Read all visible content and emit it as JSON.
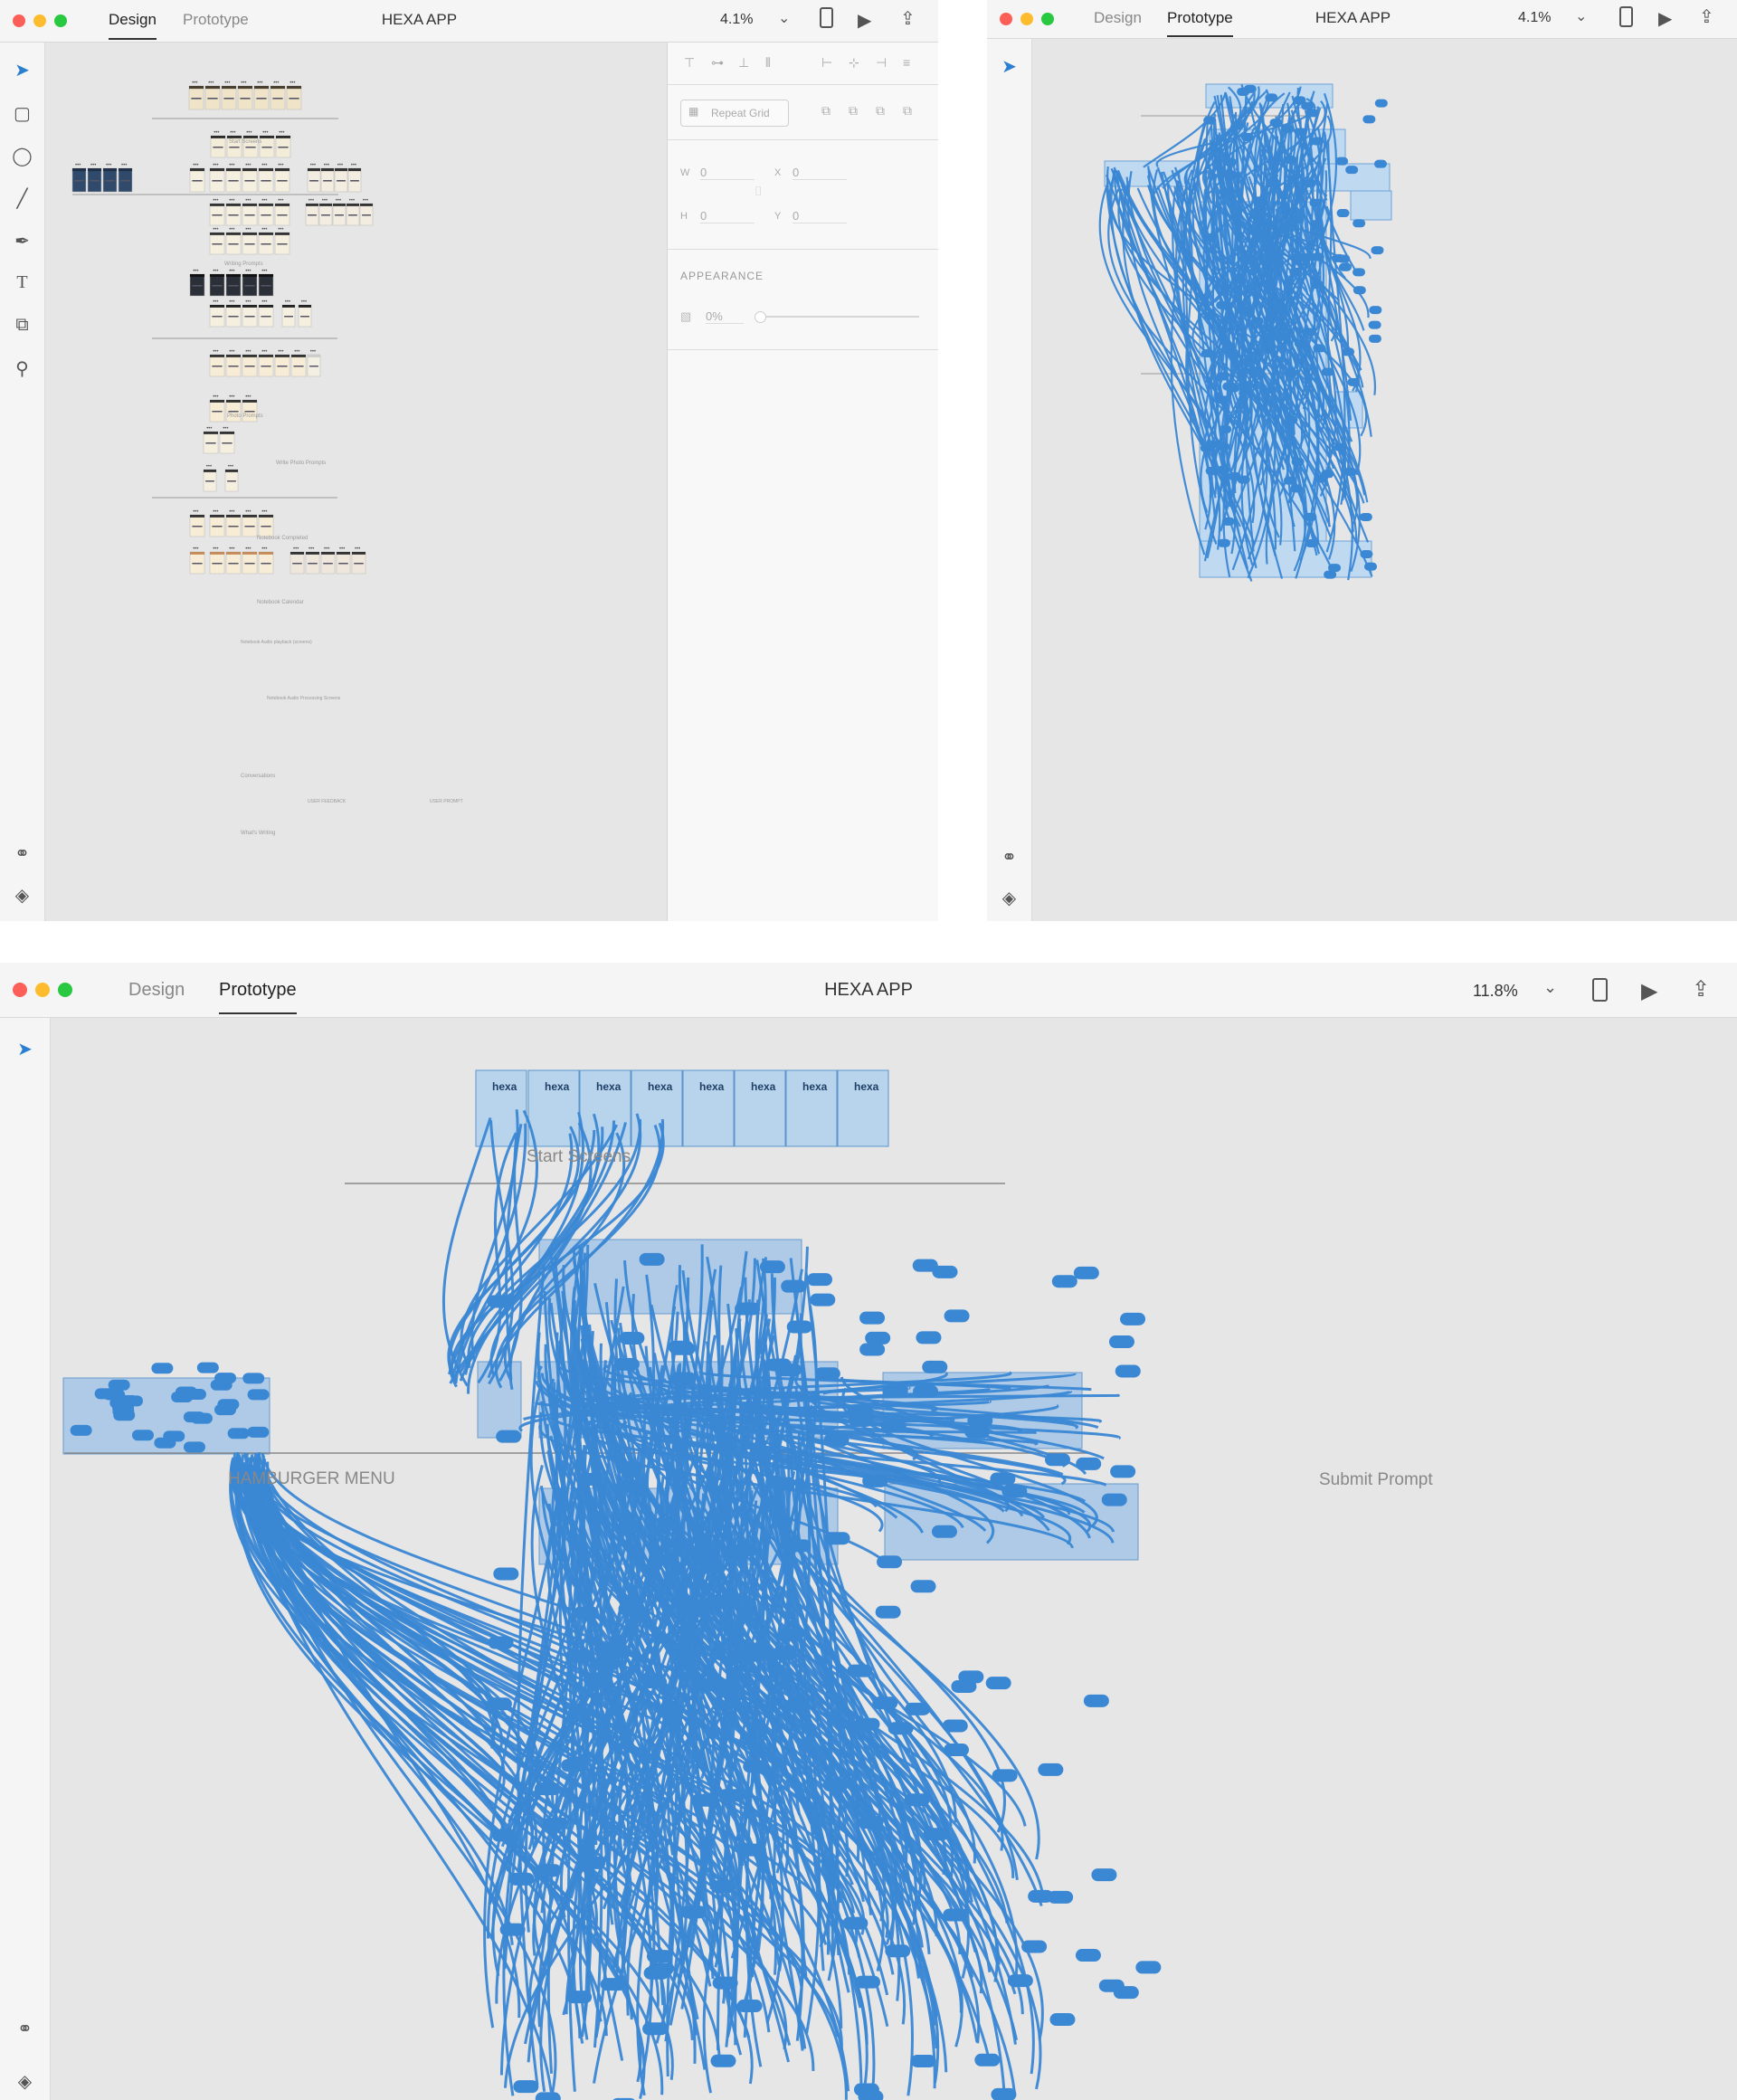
{
  "windows": [
    {
      "mode": "design",
      "tabs": [
        "Design",
        "Prototype"
      ],
      "active_tab": "Design",
      "title": "HEXA APP",
      "zoom": "4.1%",
      "canvas_labels": [
        "Start Screens",
        "Writing Prompts",
        "Photo Prompts",
        "Write Photo Prompts",
        "Notebook Completed",
        "Notebook Calendar",
        "Notebook Audio playback (screens)",
        "Notebook Audio Processing Screens",
        "Conversations",
        "What's Writing",
        "USER PROMPT",
        "USER FEEDBACK"
      ]
    },
    {
      "mode": "prototype",
      "tabs": [
        "Design",
        "Prototype"
      ],
      "active_tab": "Prototype",
      "title": "HEXA APP",
      "zoom": "4.1%"
    },
    {
      "mode": "prototype",
      "tabs": [
        "Design",
        "Prototype"
      ],
      "active_tab": "Prototype",
      "title": "HEXA APP",
      "zoom": "11.8%",
      "canvas_labels": [
        "Start Screens",
        "HAMBURGER MENU",
        "Submit Prompt"
      ],
      "artboard_brand": "hexa"
    }
  ],
  "properties_panel": {
    "repeat_grid": "Repeat Grid",
    "w_label": "W",
    "w_value": "0",
    "h_label": "H",
    "h_value": "0",
    "x_label": "X",
    "x_value": "0",
    "y_label": "Y",
    "y_value": "0",
    "appearance_heading": "APPEARANCE",
    "opacity_value": "0%"
  },
  "icons": {
    "window_controls": [
      "close-light",
      "minimize-light",
      "zoom-light"
    ],
    "design_tools": [
      "select-icon",
      "rectangle-icon",
      "ellipse-icon",
      "line-icon",
      "pen-icon",
      "text-icon",
      "artboard-icon",
      "zoom-icon"
    ],
    "bottom_tools": [
      "symbols-icon",
      "layers-icon"
    ],
    "top_right": [
      "device-preview-icon",
      "play-icon",
      "share-icon"
    ]
  },
  "colors": {
    "wire": "#3a87d4",
    "close": "#fc5f57",
    "minimize": "#fdbc2e",
    "zoom": "#28c840",
    "canvas": "#e6e6e6",
    "select_arrow": "#2b7fd1"
  }
}
